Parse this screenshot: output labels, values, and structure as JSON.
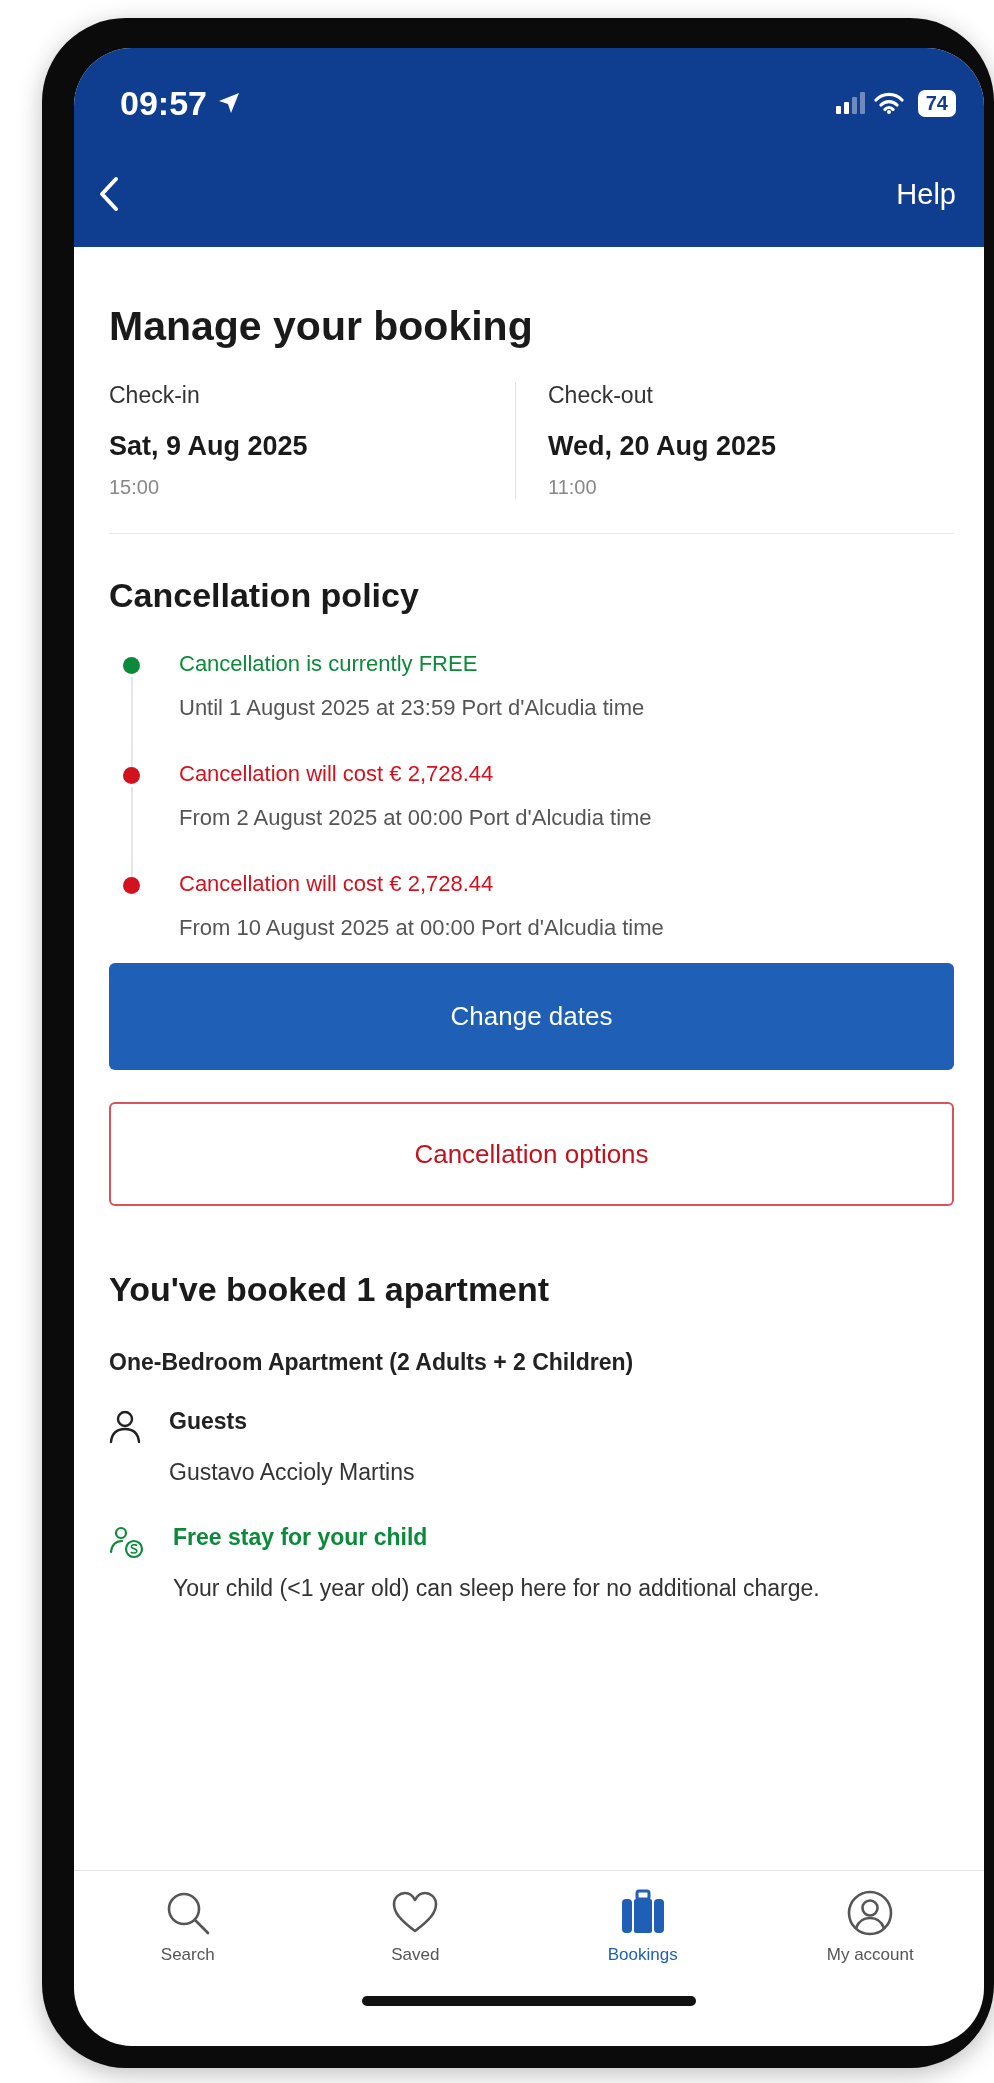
{
  "status_bar": {
    "time": "09:57",
    "battery": "74"
  },
  "header": {
    "help": "Help"
  },
  "title": "Manage your booking",
  "check_in": {
    "label": "Check-in",
    "date": "Sat, 9 Aug 2025",
    "time": "15:00"
  },
  "check_out": {
    "label": "Check-out",
    "date": "Wed, 20 Aug 2025",
    "time": "11:00"
  },
  "cancellation": {
    "title": "Cancellation policy",
    "items": [
      {
        "title": "Cancellation is currently FREE",
        "detail": "Until 1 August 2025 at 23:59 Port d'Alcudia time",
        "color": "#0a8a3a"
      },
      {
        "title": "Cancellation will cost € 2,728.44",
        "detail": "From 2 August 2025 at 00:00 Port d'Alcudia time",
        "color": "#d4111e"
      },
      {
        "title": "Cancellation will cost € 2,728.44",
        "detail": "From 10 August 2025 at 00:00 Port d'Alcudia time",
        "color": "#d4111e"
      }
    ]
  },
  "buttons": {
    "change_dates": "Change dates",
    "cancellation_options": "Cancellation options"
  },
  "booked": {
    "title": "You've booked 1 apartment",
    "room": "One-Bedroom Apartment (2 Adults + 2 Children)",
    "guests_label": "Guests",
    "guest_name": "Gustavo Accioly Martins",
    "perk_title": "Free stay for your child",
    "perk_text": "Your child (<1 year old) can sleep here for no additional charge."
  },
  "nav": [
    {
      "kind": "search",
      "label": "Search",
      "selected": false
    },
    {
      "kind": "saved",
      "label": "Saved",
      "selected": false
    },
    {
      "kind": "bookings",
      "label": "Bookings",
      "selected": true
    },
    {
      "kind": "account",
      "label": "My account",
      "selected": false
    }
  ]
}
